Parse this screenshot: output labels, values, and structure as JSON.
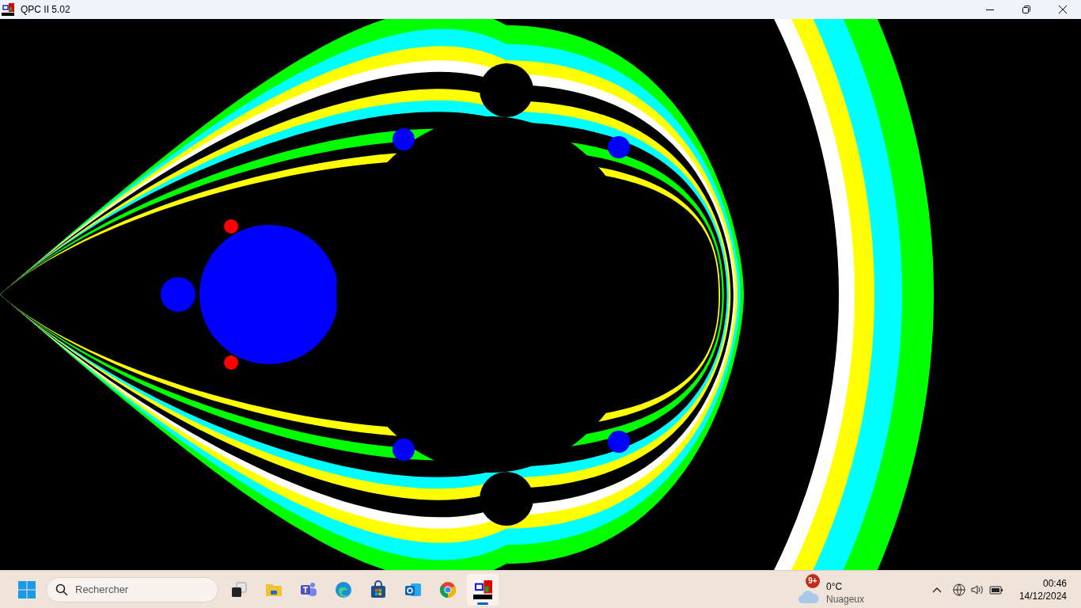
{
  "window": {
    "title": "QPC II 5.02"
  },
  "taskbar": {
    "search": {
      "placeholder": "Rechercher"
    },
    "apps": [
      {
        "kind": "taskview",
        "selected": false
      },
      {
        "kind": "folder",
        "selected": false
      },
      {
        "kind": "teams",
        "selected": false
      },
      {
        "kind": "edge",
        "selected": false
      },
      {
        "kind": "store",
        "selected": false
      },
      {
        "kind": "outlook",
        "selected": false
      },
      {
        "kind": "chrome",
        "selected": false
      },
      {
        "kind": "qpc",
        "selected": true
      }
    ],
    "weather": {
      "badge": "9+",
      "temperature": "0°C",
      "condition": "Nuageux"
    },
    "clock": {
      "time": "00:46",
      "date": "14/12/2024"
    }
  }
}
